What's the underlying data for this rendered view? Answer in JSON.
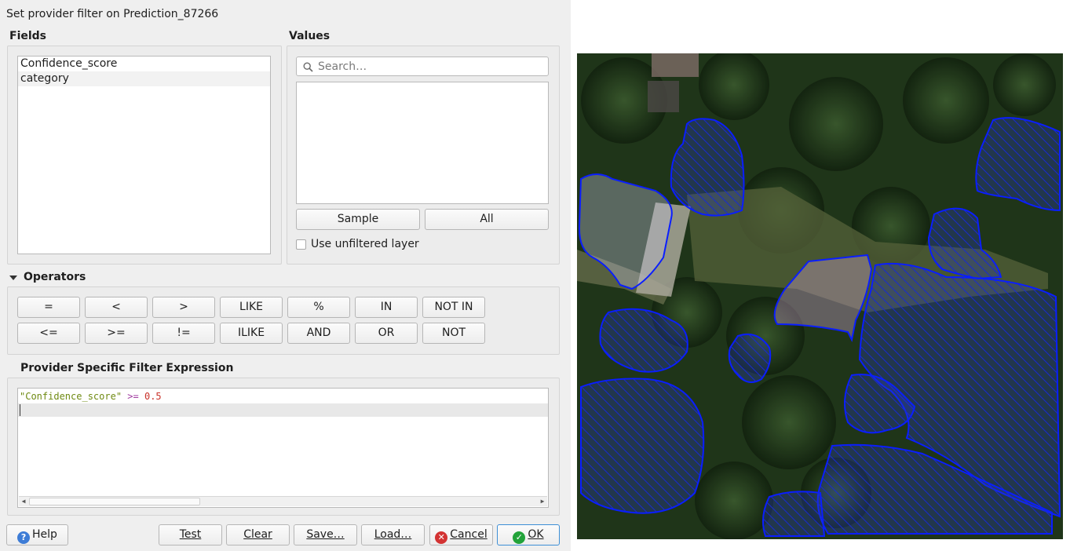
{
  "window": {
    "title": "Set provider filter on Prediction_87266"
  },
  "fields": {
    "label": "Fields",
    "items": [
      "Confidence_score",
      "category"
    ]
  },
  "values": {
    "label": "Values",
    "search_placeholder": "Search…",
    "sample_label": "Sample",
    "all_label": "All",
    "unfiltered_label": "Use unfiltered layer"
  },
  "operators": {
    "label": "Operators",
    "row1": [
      "=",
      "<",
      ">",
      "LIKE",
      "%",
      "IN",
      "NOT IN"
    ],
    "row2": [
      "<=",
      ">=",
      "!=",
      "ILIKE",
      "AND",
      "OR",
      "NOT"
    ]
  },
  "expression": {
    "label": "Provider Specific Filter Expression",
    "field_token": "\"Confidence_score\"",
    "op_token": ">=",
    "num_token": "0.5"
  },
  "buttons": {
    "help": "Help",
    "test": "Test",
    "clear": "Clear",
    "save": "Save…",
    "load": "Load…",
    "cancel": "Cancel",
    "ok": "OK"
  },
  "colors": {
    "polygon_stroke": "#0a1eff",
    "help_icon": "#3d7cd6",
    "cancel_icon": "#d33333",
    "ok_icon": "#22a33a",
    "ok_border": "#3d8fd6"
  },
  "icons": [
    "search-icon",
    "collapse-arrow-icon",
    "help-icon",
    "cancel-icon",
    "ok-check-icon"
  ]
}
